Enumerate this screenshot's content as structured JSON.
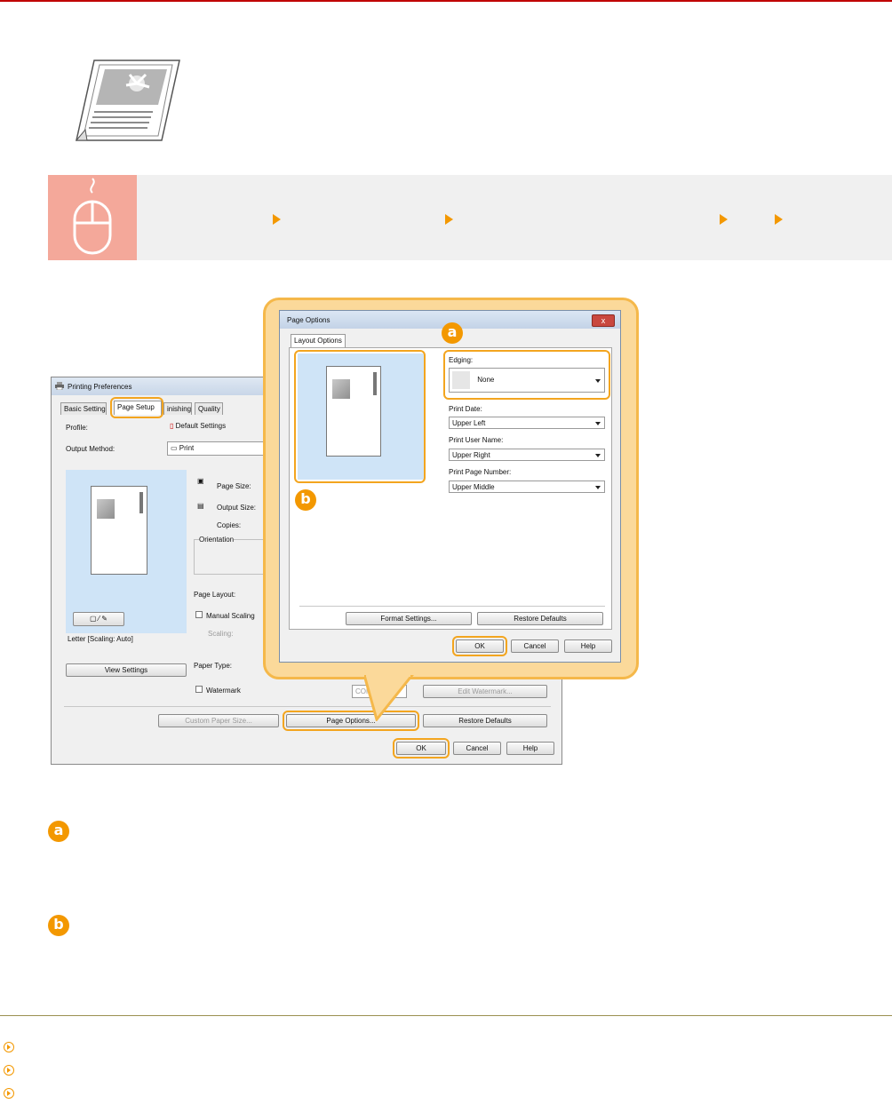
{
  "colors": {
    "accent": "#f39800",
    "topline": "#c00000",
    "mouse_box": "#f4a89a"
  },
  "hero": {
    "icon": "bordered-photo-page-icon"
  },
  "banner": {
    "icon": "mouse-click-icon",
    "arrow_icon": "orange-triangle-icon"
  },
  "printing_preferences": {
    "title": "Printing Preferences",
    "tabs": [
      "Basic Setting",
      "Page Setup",
      "inishing",
      "Quality"
    ],
    "profile_label": "Profile:",
    "profile_value": "Default Settings",
    "output_method_label": "Output Method:",
    "output_method_value": "Print",
    "page_size_label": "Page Size:",
    "output_size_label": "Output Size:",
    "copies_label": "Copies:",
    "orientation_label": "Orientation",
    "page_layout_label": "Page Layout:",
    "manual_scaling_label": "Manual Scaling",
    "scaling_label": "Scaling:",
    "paper_type_label": "Paper Type:",
    "watermark_label": "Watermark",
    "watermark_value": "CONFIDE",
    "edit_watermark_button": "Edit Watermark...",
    "preview_caption": "Letter [Scaling: Auto]",
    "view_settings_button": "View Settings",
    "custom_paper_size_button": "Custom Paper Size...",
    "page_options_button": "Page Options...",
    "restore_defaults_button": "Restore Defaults",
    "ok_button": "OK",
    "cancel_button": "Cancel",
    "help_button": "Help"
  },
  "page_options_dialog": {
    "title": "Page Options",
    "close_label": "x",
    "tab": "Layout Options",
    "edging_label": "Edging:",
    "edging_value": "None",
    "print_date_label": "Print Date:",
    "print_date_value": "Upper Left",
    "print_user_name_label": "Print User Name:",
    "print_user_name_value": "Upper Right",
    "print_page_number_label": "Print Page Number:",
    "print_page_number_value": "Upper Middle",
    "format_settings_button": "Format Settings...",
    "restore_defaults_button": "Restore Defaults",
    "ok_button": "OK",
    "cancel_button": "Cancel",
    "help_button": "Help"
  },
  "callouts": {
    "a": "a",
    "b": "b"
  },
  "footer": {
    "link_icon": "circle-arrow-link-icon"
  }
}
